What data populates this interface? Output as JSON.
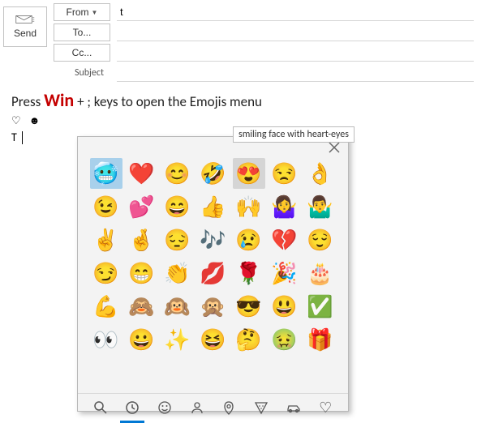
{
  "send_label": "Send",
  "from_label": "From",
  "to_label": "To...",
  "cc_label": "Cc...",
  "subject_label": "Subject",
  "from_value": "t",
  "to_value": "",
  "cc_value": "",
  "subject_value": "",
  "instruction_pre": "Press ",
  "instruction_win": "Win",
  "instruction_post": " + ; keys to open the Emojis menu",
  "body_prefix": "T",
  "tooltip": "smiling face with heart-eyes",
  "emojis": {
    "r0": [
      "🥶",
      "❤️",
      "😊",
      "🤣",
      "😍",
      "😒",
      "👌"
    ],
    "r1": [
      "😉",
      "💕",
      "😄",
      "👍",
      "🙌",
      "🤷‍♀️",
      "🤷‍♂️"
    ],
    "r2": [
      "✌️",
      "🤞",
      "😔",
      "🎶",
      "😢",
      "💔",
      "😌"
    ],
    "r3": [
      "😏",
      "😁",
      "👏",
      "💋",
      "🌹",
      "🎉",
      "🎂"
    ],
    "r4": [
      "💪",
      "🙈",
      "🙉",
      "🙊",
      "😎",
      "😃",
      "✅"
    ],
    "r5": [
      "👀",
      "😀",
      "✨",
      "😆",
      "🤔",
      "🤢",
      "🎁"
    ]
  },
  "categories": [
    "search",
    "recent",
    "smile",
    "people",
    "place",
    "food",
    "car",
    "heart"
  ]
}
